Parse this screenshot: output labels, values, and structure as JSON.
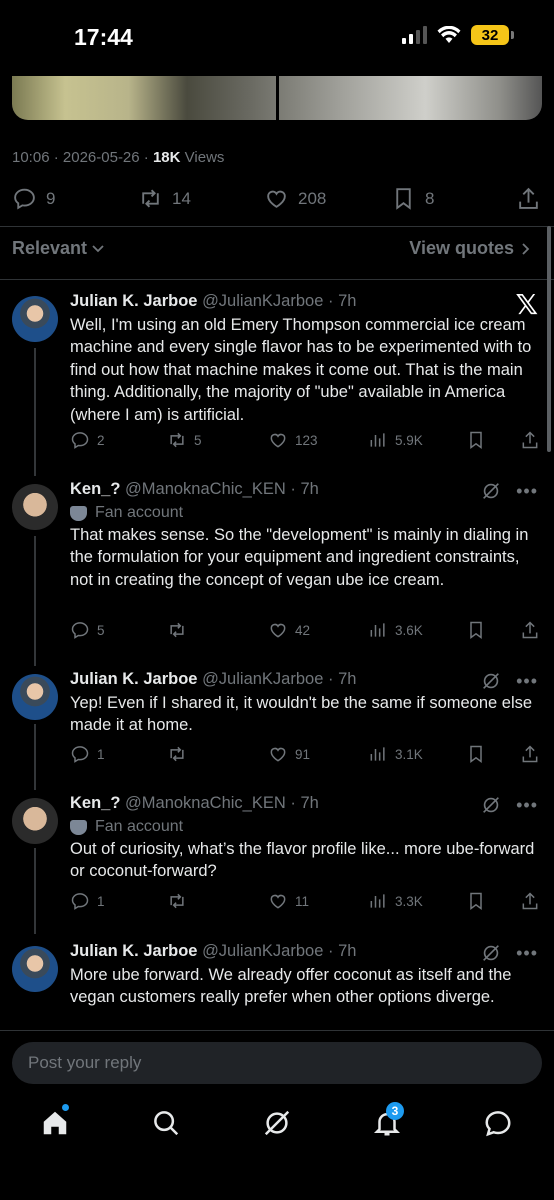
{
  "status_bar": {
    "time": "17:44",
    "battery": "32"
  },
  "post": {
    "time": "10:06",
    "date": "2026-05-26",
    "views_count": "18K",
    "views_label": "Views",
    "replies": "9",
    "reposts": "14",
    "likes": "208",
    "bookmarks": "8"
  },
  "sort": {
    "label": "Relevant",
    "view_quotes": "View quotes"
  },
  "replies": [
    {
      "name": "Julian K. Jarboe",
      "handle": "@JulianKJarboe",
      "time": "7h",
      "text": "Well, I'm using an old Emery Thompson commercial ice cream machine and every single flavor has to be experimented with to find out how that machine makes it come out.  That is the main thing.  Additionally, the majority of \"ube\" available in America (where I am) is artificial.",
      "replies": "2",
      "reposts": "5",
      "likes": "123",
      "views": "5.9K"
    },
    {
      "name": "Ken_?",
      "handle": "@ManoknaChic_KEN",
      "time": "7h",
      "badge": "Fan account",
      "text": "That makes sense. So the \"development\" is mainly in dialing in the formulation for your equipment and ingredient constraints, not in creating the concept of vegan ube ice cream.",
      "replies": "5",
      "reposts": "",
      "likes": "42",
      "views": "3.6K"
    },
    {
      "name": "Julian K. Jarboe",
      "handle": "@JulianKJarboe",
      "time": "7h",
      "text": "Yep! Even if I shared it, it wouldn't be the same if someone else made it at home.",
      "replies": "1",
      "reposts": "",
      "likes": "91",
      "views": "3.1K"
    },
    {
      "name": "Ken_?",
      "handle": "@ManoknaChic_KEN",
      "time": "7h",
      "badge": "Fan account",
      "text": "Out of curiosity, what’s the flavor profile like... more ube-forward or coconut-forward?",
      "replies": "1",
      "reposts": "",
      "likes": "11",
      "views": "3.3K"
    },
    {
      "name": "Julian K. Jarboe",
      "handle": "@JulianKJarboe",
      "time": "7h",
      "text": "More ube forward. We already offer coconut as itself and the vegan customers really prefer when other options diverge."
    }
  ],
  "composer": {
    "placeholder": "Post your reply"
  },
  "nav": {
    "notifications_badge": "3"
  },
  "icons": [
    "reply-icon",
    "repost-icon",
    "like-icon",
    "bookmark-icon",
    "share-icon",
    "views-icon",
    "grok-icon",
    "more-icon",
    "x-logo",
    "home-icon",
    "search-icon",
    "notifications-icon",
    "messages-icon"
  ],
  "colors": {
    "background": "#000000",
    "accent": "#1d9bf0",
    "muted": "#71767b",
    "battery": "#f5c518"
  }
}
